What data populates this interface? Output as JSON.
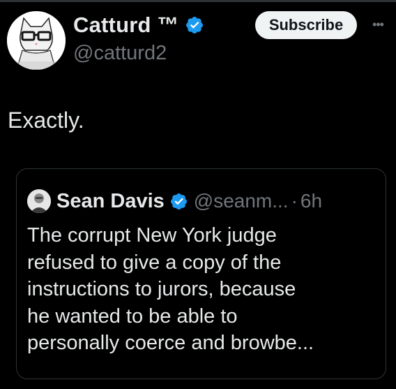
{
  "author": {
    "display_name": "Catturd ™",
    "handle": "@catturd2",
    "avatar_icon": "cat-with-glasses-avatar",
    "verified_icon": "verified-badge-icon"
  },
  "subscribe_label": "Subscribe",
  "more_label": "•••",
  "tweet": {
    "text": "Exactly."
  },
  "quote": {
    "display_name": "Sean Davis",
    "handle": "@seanm...",
    "separator": "·",
    "time": "6h",
    "lines": [
      "The corrupt New York judge",
      "refused to give a copy of the",
      "instructions to jurors, because",
      "he wanted to be able to",
      "personally coerce and browbe..."
    ]
  },
  "colors": {
    "background": "#000000",
    "text_primary": "#e7e9ea",
    "text_secondary": "#71767b",
    "verified_blue": "#1d9bf0",
    "border": "#2f3336",
    "button_bg": "#eff3f4"
  }
}
